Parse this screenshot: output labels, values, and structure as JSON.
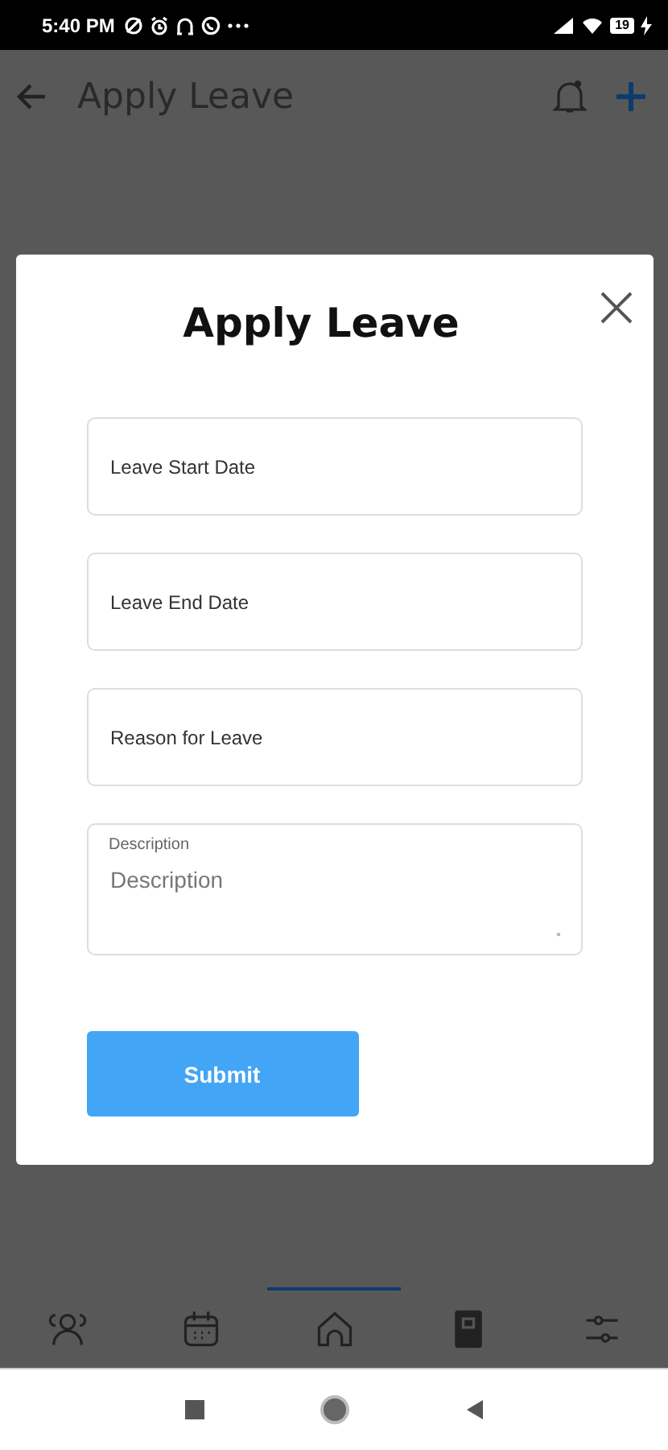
{
  "status_bar": {
    "time": "5:40 PM",
    "battery": "19"
  },
  "app_bar": {
    "title": "Apply Leave"
  },
  "dialog": {
    "title": "Apply Leave",
    "fields": [
      {
        "kind": "text",
        "placeholder": "Leave Start Date"
      },
      {
        "kind": "text",
        "placeholder": "Leave End Date"
      },
      {
        "kind": "text",
        "placeholder": "Reason for Leave"
      },
      {
        "kind": "textarea",
        "label": "Description",
        "placeholder": "Description"
      }
    ],
    "submit": "Submit"
  },
  "bottom_nav": [
    {
      "kind": "people",
      "selected": false
    },
    {
      "kind": "calendar",
      "selected": false
    },
    {
      "kind": "home",
      "selected": true
    },
    {
      "kind": "book",
      "selected": false
    },
    {
      "kind": "sliders",
      "selected": false
    }
  ]
}
